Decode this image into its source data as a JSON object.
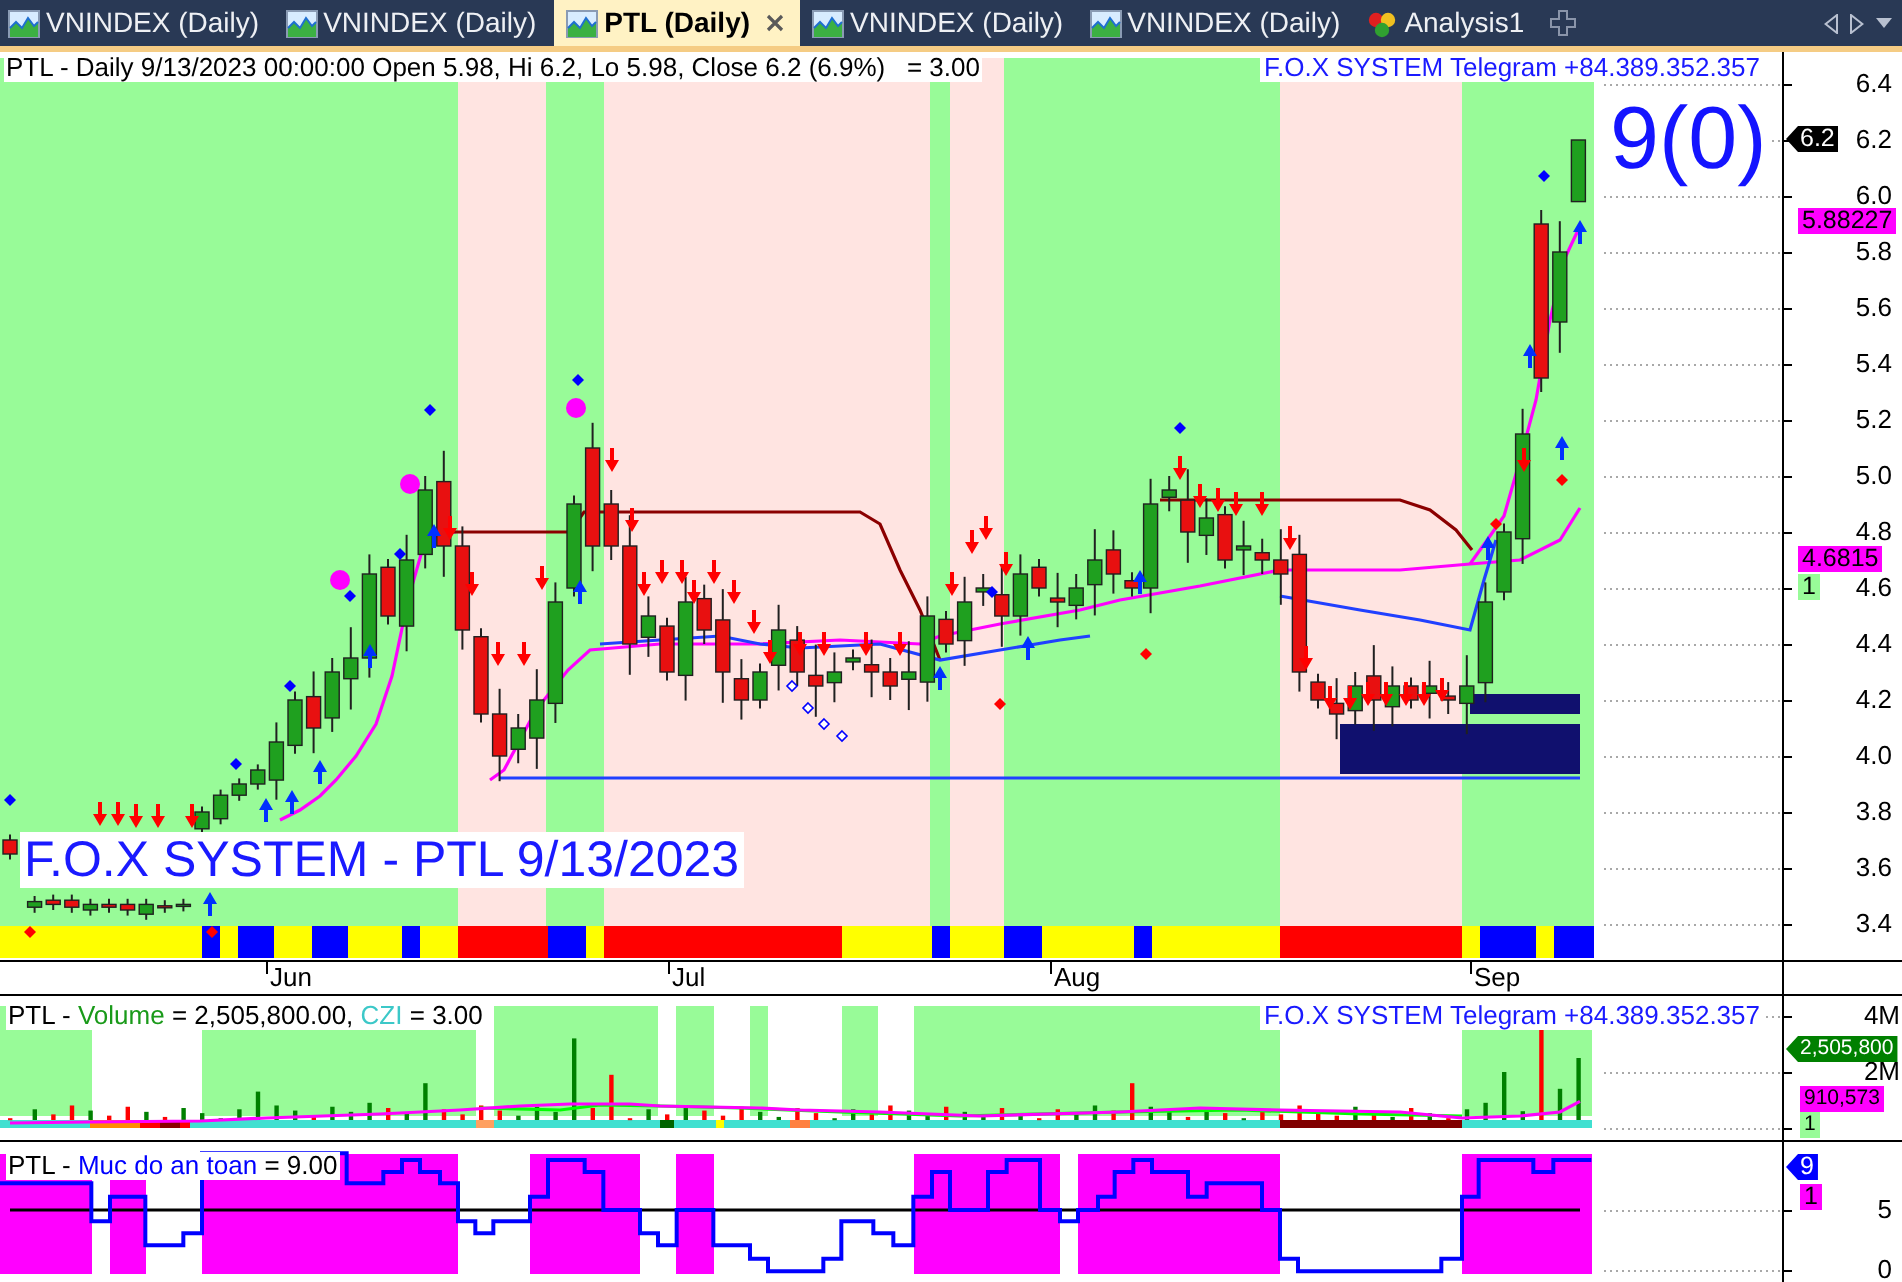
{
  "tabs": [
    {
      "label": "VNINDEX (Daily)",
      "kind": "chart",
      "selected": false
    },
    {
      "label": "VNINDEX (Daily)",
      "kind": "chart",
      "selected": false
    },
    {
      "label": "PTL (Daily)",
      "kind": "chart",
      "selected": true
    },
    {
      "label": "VNINDEX (Daily)",
      "kind": "chart",
      "selected": false
    },
    {
      "label": "VNINDEX (Daily)",
      "kind": "chart",
      "selected": false
    },
    {
      "label": "Analysis1",
      "kind": "analysis",
      "selected": false
    }
  ],
  "price_pane": {
    "header": "PTL - Daily 9/13/2023 00:00:00 Open 5.98, Hi 6.2, Lo 5.98, Close 6.2 (6.9%)   = 3.00",
    "contact": "F.O.X SYSTEM Telegram +84.389.352.357",
    "signal_count": "9(0)",
    "caption": "F.O.X SYSTEM - PTL 9/13/2023",
    "axis_ticks": [
      "6.4",
      "6.2",
      "6.0",
      "5.8",
      "5.6",
      "5.4",
      "5.2",
      "5.0",
      "4.8",
      "4.6",
      "4.4",
      "4.2",
      "4.0",
      "3.8",
      "3.6",
      "3.4"
    ],
    "badges": [
      {
        "text": "6.2",
        "kind": "pointer",
        "color": "#000000"
      },
      {
        "text": "5.88227",
        "kind": "tag",
        "color": "#ff00ff"
      },
      {
        "text": "4.6815",
        "kind": "tag",
        "color": "#ff00ff"
      },
      {
        "text": "1",
        "kind": "tag",
        "color": "#98fb98"
      }
    ]
  },
  "date_axis": {
    "months": [
      "Jun",
      "Jul",
      "Aug",
      "Sep"
    ]
  },
  "volume_pane": {
    "legend": {
      "symbol": "PTL -",
      "series": [
        {
          "name": "Volume",
          "value": "= 2,505,800.00,",
          "color": "#1a9a1a"
        },
        {
          "name": "CZI",
          "value": "= 3.00",
          "color": "#3cc8c8"
        }
      ]
    },
    "contact": "F.O.X SYSTEM Telegram +84.389.352.357",
    "axis_ticks": [
      "4M",
      "2M"
    ],
    "badges": [
      {
        "text": "2,505,800",
        "kind": "pointer",
        "color": "#008000"
      },
      {
        "text": "910,573",
        "kind": "tag",
        "color": "#ff00ff"
      },
      {
        "text": "1",
        "kind": "tag",
        "color": "#98fb98"
      }
    ]
  },
  "safety_pane": {
    "legend": {
      "symbol": "PTL -",
      "series": [
        {
          "name": "Muc do an toan",
          "value": "= 9.00",
          "color": "#0000ff"
        }
      ]
    },
    "axis_ticks": [
      "5",
      "0"
    ],
    "badges": [
      {
        "text": "9",
        "kind": "pointer",
        "color": "#0000ff"
      },
      {
        "text": "1",
        "kind": "tag",
        "color": "#ff00ff"
      }
    ]
  }
}
